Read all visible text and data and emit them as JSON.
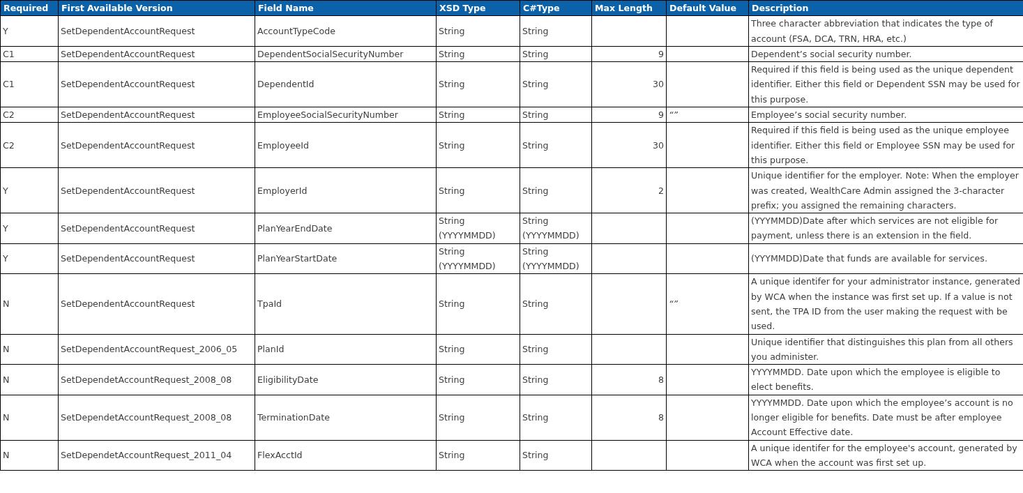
{
  "table": {
    "columns": [
      "Required",
      "First Available Version",
      "Field Name",
      "XSD Type",
      "C#Type",
      "Max Length",
      "Default Value",
      "Description"
    ],
    "rows": [
      {
        "required": "Y",
        "version": "SetDependentAccountRequest",
        "field_name": "AccountTypeCode",
        "xsd_type": "String",
        "csharp_type": "String",
        "description": "Three character abbreviation that indicates the type of account (FSA, DCA, TRN, HRA, etc.)"
      },
      {
        "required": "C1",
        "version": "SetDependentAccountRequest",
        "field_name": "DependentSocialSecurityNumber",
        "xsd_type": "String",
        "csharp_type": "String",
        "max_length": "9",
        "description": "Dependent’s social security number."
      },
      {
        "required": "C1",
        "version": "SetDependentAccountRequest",
        "field_name": "DependentId",
        "xsd_type": "String",
        "csharp_type": "String",
        "max_length": "30",
        "description": "Required if this field is being used as the unique dependent identifier.  Either this field or Dependent SSN may be used for this purpose."
      },
      {
        "required": "C2",
        "version": "SetDependentAccountRequest",
        "field_name": "EmployeeSocialSecurityNumber",
        "xsd_type": "String",
        "csharp_type": "String",
        "max_length": "9",
        "default_value": "“”",
        "description": "Employee’s social security number."
      },
      {
        "required": "C2",
        "version": "SetDependentAccountRequest",
        "field_name": "EmployeeId",
        "xsd_type": "String",
        "csharp_type": "String",
        "max_length": "30",
        "description": "Required if this field is being used as the unique employee identifier. Either this field or Employee SSN may be used for this purpose."
      },
      {
        "required": "Y",
        "version": "SetDependentAccountRequest",
        "field_name": "EmployerId",
        "xsd_type": "String",
        "csharp_type": "String",
        "max_length": "2",
        "description": "Unique identifier for the employer. Note: When the employer was created, WealthCare Admin assigned the 3-character prefix; you assigned the remaining characters."
      },
      {
        "required": "Y",
        "version": "SetDependentAccountRequest",
        "field_name": "PlanYearEndDate",
        "xsd_type": "String (YYYYMMDD)",
        "csharp_type": "String (YYYYMMDD)",
        "description": "(YYYMMDD)Date after which services are not eligible for payment, unless there is an extension in the field."
      },
      {
        "required": "Y",
        "version": "SetDependentAccountRequest",
        "field_name": "PlanYearStartDate",
        "xsd_type": "String (YYYYMMDD)",
        "csharp_type": "String (YYYYMMDD)",
        "description": "(YYYMMDD)Date that funds are available for services."
      },
      {
        "required": "N",
        "version": "SetDependentAccountRequest",
        "field_name": "TpaId",
        "xsd_type": "String",
        "csharp_type": "String",
        "default_value": "“”",
        "description": "A unique identifer for your administrator instance, generated by WCA when the instance was first set up. If a value is not sent, the TPA ID from the user making the request with be used."
      },
      {
        "required": "N",
        "version": "SetDependentAccountRequest_2006_05",
        "field_name": "PlanId",
        "xsd_type": "String",
        "csharp_type": "String",
        "description": "Unique identifier that distinguishes this plan from all others you administer."
      },
      {
        "required": "N",
        "version": "SetDependetAccountRequest_2008_08",
        "field_name": "EligibilityDate",
        "xsd_type": "String",
        "csharp_type": "String",
        "max_length": "8",
        "description": "YYYYMMDD. Date upon which the employee is eligible to elect benefits."
      },
      {
        "required": "N",
        "version": "SetDependetAccountRequest_2008_08",
        "field_name": "TerminationDate",
        "xsd_type": "String",
        "csharp_type": "String",
        "max_length": "8",
        "description": "YYYYMMDD. Date upon which the employee’s account is no longer eligible for benefits. Date must be after employee Account Effective date."
      },
      {
        "required": "N",
        "version": "SetDependetAccountRequest_2011_04",
        "field_name": "FlexAcctId",
        "xsd_type": "String",
        "csharp_type": "String",
        "description": "A unique identifer for the employee's account, generated by WCA when the account was first set up."
      }
    ]
  }
}
